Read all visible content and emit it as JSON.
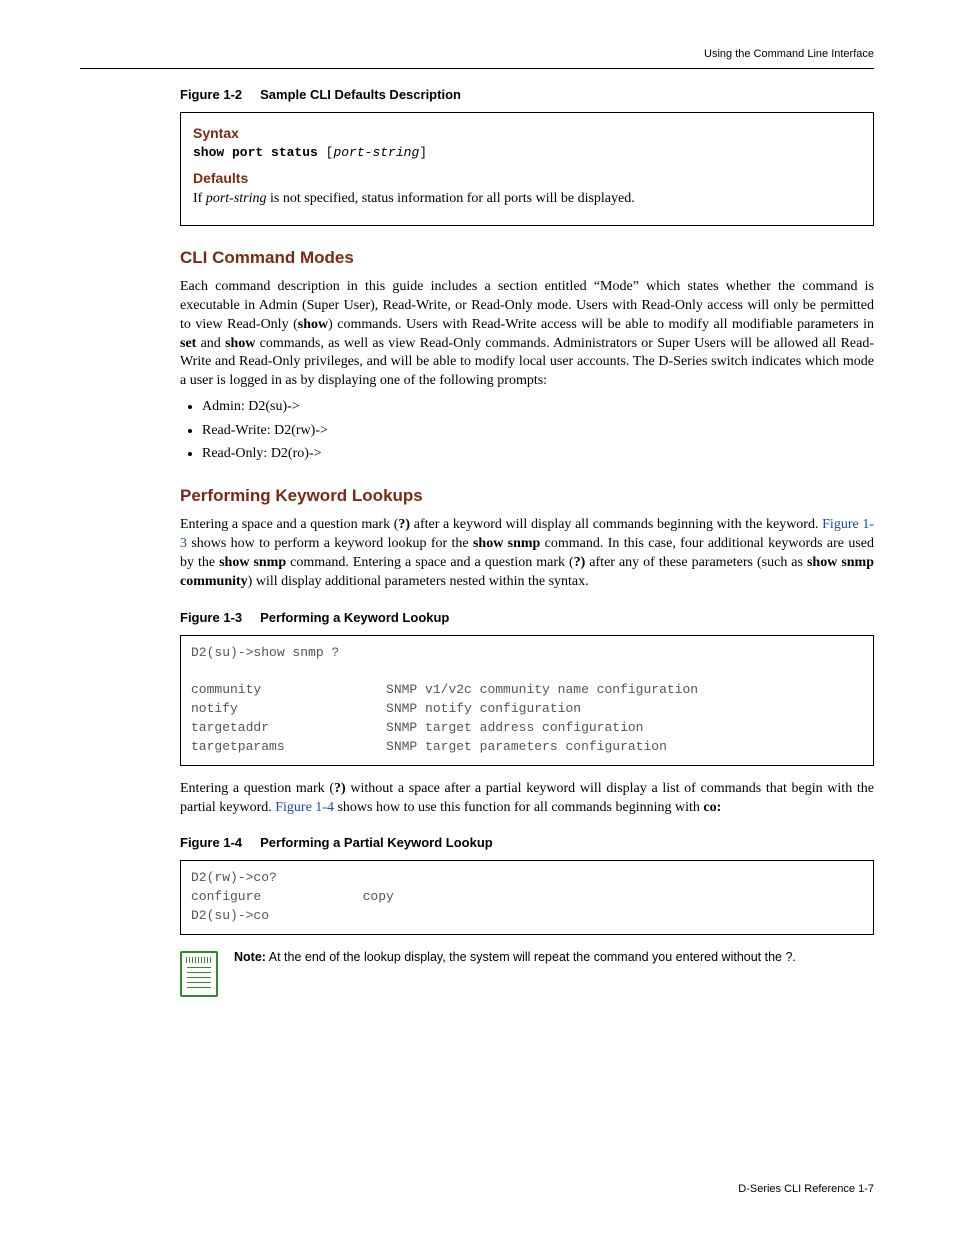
{
  "running_head": "Using the Command Line Interface",
  "fig12": {
    "num": "Figure 1-2",
    "title": "Sample CLI Defaults Description"
  },
  "box1": {
    "syntax_head": "Syntax",
    "syntax_cmd": "show port status",
    "syntax_arg_open": " [",
    "syntax_arg": "port-string",
    "syntax_arg_close": "]",
    "defaults_head": "Defaults",
    "defaults_text_pre": "If ",
    "defaults_text_italic": "port-string",
    "defaults_text_post": " is not specified, status information for all ports will be displayed."
  },
  "modes": {
    "head": "CLI Command Modes",
    "p1a": "Each command description in this guide includes a section entitled “Mode” which states whether the command is executable in Admin (Super User), Read-Write, or Read-Only mode. Users with Read-Only access will only be permitted to view Read-Only (",
    "p1b": "show",
    "p1c": ") commands. Users with Read-Write access will be able to modify all modifiable parameters in ",
    "p1d": "set",
    "p1e": " and ",
    "p1f": "show",
    "p1g": " commands, as well as view Read-Only commands. Administrators or Super Users will be allowed all Read-Write and Read-Only privileges, and will be able to modify local user accounts. The D-Series switch indicates which mode a user is logged in as by displaying one of the following prompts:",
    "bullets": [
      "Admin: D2(su)->",
      "Read-Write: D2(rw)->",
      "Read-Only: D2(ro)->"
    ]
  },
  "lookup": {
    "head": "Performing Keyword Lookups",
    "p1a": "Entering a space and a question mark (",
    "p1b": "?)",
    "p1c": " after a keyword will display all commands beginning with the keyword. ",
    "p1link": "Figure 1-3",
    "p1d": " shows how to perform a keyword lookup for the ",
    "p1e": "show snmp",
    "p1f": " command. In this case, four additional keywords are used by the ",
    "p1g": "show snmp",
    "p1h": " command. Entering a space and a question mark (",
    "p1i": "?)",
    "p1j": " after any of these parameters (such as ",
    "p1k": "show snmp community",
    "p1l": ") will display additional parameters nested within the syntax."
  },
  "fig13": {
    "num": "Figure 1-3",
    "title": "Performing a Keyword Lookup"
  },
  "term1": "D2(su)->show snmp ?\n\ncommunity                SNMP v1/v2c community name configuration\nnotify                   SNMP notify configuration\ntargetaddr               SNMP target address configuration\ntargetparams             SNMP target parameters configuration",
  "partial": {
    "p1a": "Entering a question mark (",
    "p1b": "?)",
    "p1c": " without a space after a partial keyword will display a list of commands that begin with the partial keyword. ",
    "p1link": "Figure 1-4",
    "p1d": " shows how to use this function for all commands beginning with ",
    "p1e": "co:"
  },
  "fig14": {
    "num": "Figure 1-4",
    "title": "Performing a Partial Keyword Lookup"
  },
  "term2": "D2(rw)->co?\nconfigure             copy\nD2(su)->co",
  "note": {
    "label": "Note:",
    "text": " At the end of the lookup display, the system will repeat the command you entered without the ?."
  },
  "footer": "D-Series CLI Reference   1-7"
}
